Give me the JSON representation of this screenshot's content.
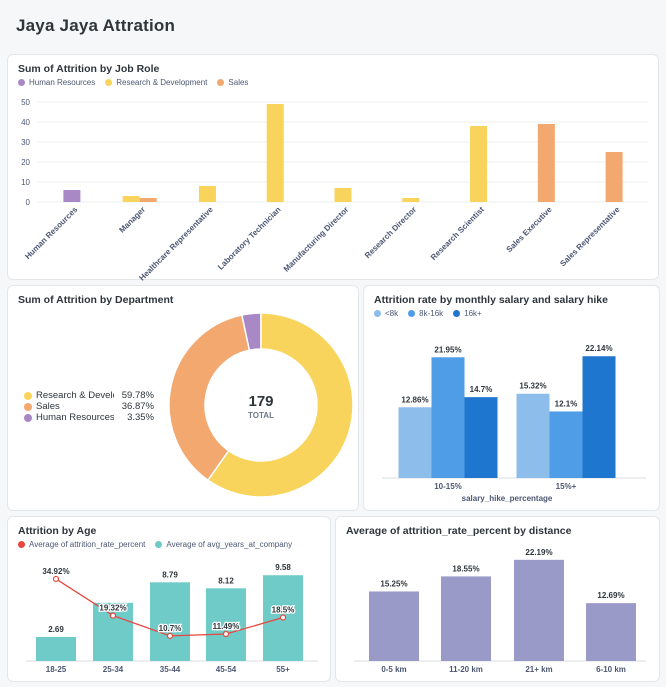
{
  "dashboard": {
    "title": "Jaya Jaya Attration"
  },
  "job_role_card": {
    "title": "Sum of Attrition by Job Role",
    "legend": [
      {
        "label": "Human Resources",
        "color": "#a989c5"
      },
      {
        "label": "Research & Development",
        "color": "#f9d45c"
      },
      {
        "label": "Sales",
        "color": "#f2a86f"
      }
    ]
  },
  "department_card": {
    "title": "Sum of Attrition by Department",
    "total_value": "179",
    "total_label": "TOTAL",
    "legend": [
      {
        "label": "Research & Develop",
        "pct": "59.78%",
        "color": "#f9d45c"
      },
      {
        "label": "Sales",
        "pct": "36.87%",
        "color": "#f2a86f"
      },
      {
        "label": "Human Resources",
        "pct": "3.35%",
        "color": "#a989c5"
      }
    ]
  },
  "salary_card": {
    "title": "Attrition rate by monthly salary and salary hike",
    "legend": [
      {
        "label": "<8k",
        "color": "#8dbdeb"
      },
      {
        "label": "8k-16k",
        "color": "#4f9de6"
      },
      {
        "label": "16k+",
        "color": "#1f76cf"
      }
    ]
  },
  "age_card": {
    "title": "Attrition by Age",
    "legend": [
      {
        "label": "Average of attrition_rate_percent",
        "color": "#e8473f"
      },
      {
        "label": "Average of avg_years_at_company",
        "color": "#6fcbc7"
      }
    ]
  },
  "distance_card": {
    "title": "Average of attrition_rate_percent by distance"
  },
  "chart_data": [
    {
      "id": "job_role",
      "type": "bar",
      "title": "Sum of Attrition by Job Role",
      "categories": [
        "Human Resources",
        "Manager",
        "Healthcare Representative",
        "Laboratory Technician",
        "Manufacturing Director",
        "Research Director",
        "Research Scientist",
        "Sales Executive",
        "Sales Representative"
      ],
      "series": [
        {
          "name": "Human Resources",
          "values": [
            6,
            0,
            0,
            0,
            0,
            0,
            0,
            0,
            0
          ]
        },
        {
          "name": "Research & Development",
          "values": [
            0,
            3,
            8,
            49,
            7,
            2,
            38,
            0,
            0
          ]
        },
        {
          "name": "Sales",
          "values": [
            0,
            2,
            0,
            0,
            0,
            0,
            0,
            39,
            25
          ]
        }
      ],
      "yticks": [
        0,
        10,
        20,
        30,
        40,
        50
      ],
      "ylim": [
        0,
        50
      ],
      "grid": true,
      "legend": "top-left"
    },
    {
      "id": "department",
      "type": "pie",
      "title": "Sum of Attrition by Department",
      "categories": [
        "Research & Develop",
        "Sales",
        "Human Resources"
      ],
      "values": [
        59.78,
        36.87,
        3.35
      ],
      "total": 179,
      "legend": "left"
    },
    {
      "id": "salary",
      "type": "bar",
      "title": "Attrition rate by monthly salary and salary hike",
      "xlabel": "salary_hike_percentage",
      "categories": [
        "10-15%",
        "15%+"
      ],
      "series": [
        {
          "name": "<8k",
          "values": [
            12.86,
            15.32
          ],
          "labels": [
            "12.86%",
            "15.32%"
          ]
        },
        {
          "name": "8k-16k",
          "values": [
            21.95,
            12.1
          ],
          "labels": [
            "21.95%",
            "12.1%"
          ]
        },
        {
          "name": "16k+",
          "values": [
            14.7,
            22.14
          ],
          "labels": [
            "14.7%",
            "22.14%"
          ]
        }
      ],
      "ylim": [
        0,
        24
      ],
      "legend": "top-left"
    },
    {
      "id": "age",
      "type": "bar",
      "title": "Attrition by Age",
      "categories": [
        "18-25",
        "25-34",
        "35-44",
        "45-54",
        "55+"
      ],
      "series": [
        {
          "name": "Average of avg_years_at_company",
          "kind": "bar",
          "values": [
            2.69,
            6.5,
            8.79,
            8.12,
            9.58
          ],
          "labels": [
            "2.69",
            "",
            "8.79",
            "8.12",
            "9.58"
          ]
        },
        {
          "name": "Average of attrition_rate_percent",
          "kind": "line",
          "values": [
            34.92,
            19.32,
            10.7,
            11.49,
            18.5
          ],
          "labels": [
            "34.92%",
            "19.32%",
            "10.7%",
            "11.49%",
            "18.5%"
          ]
        }
      ],
      "ylim_bar": [
        0,
        10.5
      ],
      "ylim_line": [
        0,
        40
      ],
      "legend": "top-left"
    },
    {
      "id": "distance",
      "type": "bar",
      "title": "Average of attrition_rate_percent by distance",
      "categories": [
        "0-5 km",
        "11-20 km",
        "21+ km",
        "6-10 km"
      ],
      "values": [
        15.25,
        18.55,
        22.19,
        12.69
      ],
      "labels": [
        "15.25%",
        "18.55%",
        "22.19%",
        "12.69%"
      ],
      "ylim": [
        0,
        25
      ]
    }
  ]
}
